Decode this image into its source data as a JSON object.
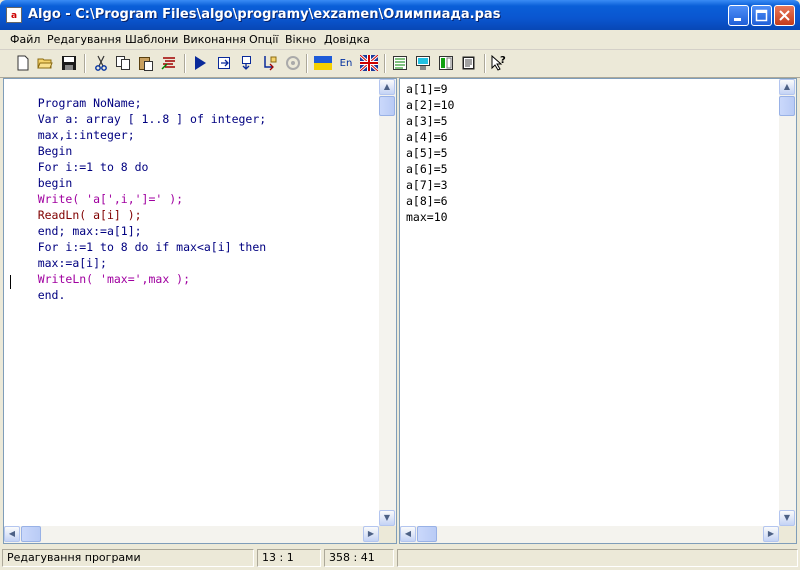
{
  "window": {
    "title": "Algo - C:\\Program Files\\algo\\programy\\exzamen\\Олимпиада.pas",
    "icon": "app-icon"
  },
  "menu": [
    "Файл",
    "Редагування",
    "Шаблони",
    "Виконання",
    "Опції",
    "Вікно",
    "Довідка"
  ],
  "toolbar": {
    "language_label": "En",
    "buttons": [
      "new-file-icon",
      "open-folder-icon",
      "save-icon",
      "cut-icon",
      "copy-icon",
      "paste-icon",
      "format-icon",
      "run-icon",
      "step-into-icon",
      "step-over-icon",
      "trace-icon",
      "stop-icon",
      "ukrainian-flag-icon",
      "english-label-icon",
      "uk-flag-icon",
      "window-layout-1-icon",
      "window-layout-2-icon",
      "window-layout-3-icon",
      "window-layout-4-icon",
      "help-pointer-icon"
    ]
  },
  "editor": {
    "lines": [
      "Program NoName;",
      "Var a: array [ 1..8 ] of integer;",
      "max,i:integer;",
      "Begin",
      "For i:=1 to 8 do",
      "begin",
      "Write( 'a[',i,']=' );",
      "ReadLn( a[i] );",
      "end; max:=a[1];",
      "For i:=1 to 8 do if max<a[i] then",
      "max:=a[i];",
      "WriteLn( 'max=',max );",
      "end."
    ]
  },
  "output": {
    "lines": [
      "a[1]=9",
      "a[2]=10",
      "a[3]=5",
      "a[4]=6",
      "a[5]=5",
      "a[6]=5",
      "a[7]=3",
      "a[8]=6",
      "max=10"
    ]
  },
  "status": {
    "mode": "Редагування програми",
    "position": "13 :  1",
    "size": "358 : 41"
  },
  "colors": {
    "keyword": "#000080",
    "type": "#800000",
    "string": "#a000a0",
    "titlebar": "#0a56d0"
  }
}
